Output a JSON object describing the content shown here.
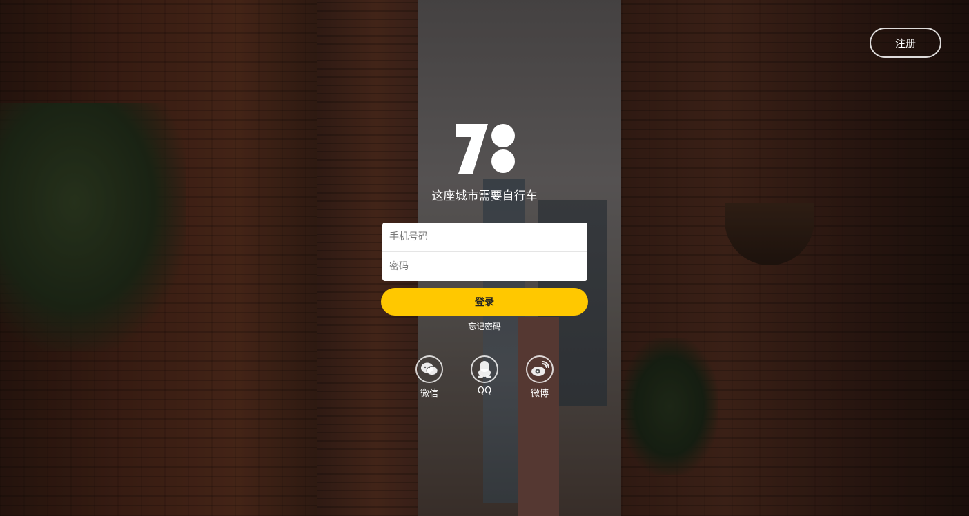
{
  "header": {
    "register_label": "注册"
  },
  "brand": {
    "logo_icon": "seven-dots-logo-icon",
    "tagline": "这座城市需要自行车"
  },
  "login_form": {
    "phone_placeholder": "手机号码",
    "password_placeholder": "密码",
    "login_label": "登录",
    "forgot_label": "忘记密码"
  },
  "social": [
    {
      "label": "微信",
      "icon": "wechat-icon"
    },
    {
      "label": "QQ",
      "icon": "qq-icon"
    },
    {
      "label": "微博",
      "icon": "weibo-icon"
    }
  ],
  "colors": {
    "accent": "#ffc800"
  }
}
